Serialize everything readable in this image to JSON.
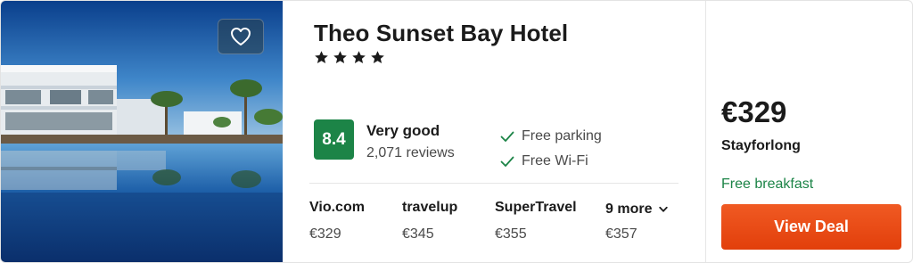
{
  "photo": {
    "favorite_icon": "heart-icon"
  },
  "hotel": {
    "name": "Theo Sunset Bay Hotel",
    "stars": 4
  },
  "rating": {
    "score": "8.4",
    "label": "Very good",
    "reviews": "2,071 reviews",
    "color": "#1c8447"
  },
  "amenities": [
    {
      "label": "Free parking",
      "icon": "check-icon"
    },
    {
      "label": "Free Wi-Fi",
      "icon": "check-icon"
    }
  ],
  "providers": [
    {
      "name": "Vio.com",
      "price": "€329"
    },
    {
      "name": "travelup",
      "price": "€345"
    },
    {
      "name": "SuperTravel",
      "price": "€355"
    },
    {
      "name": "9 more",
      "price": "€357",
      "icon": "chevron-down-icon"
    }
  ],
  "deal": {
    "price": "€329",
    "provider": "Stayforlong",
    "extra": "Free breakfast",
    "button_label": "View Deal",
    "button_color": "#e8470f"
  }
}
